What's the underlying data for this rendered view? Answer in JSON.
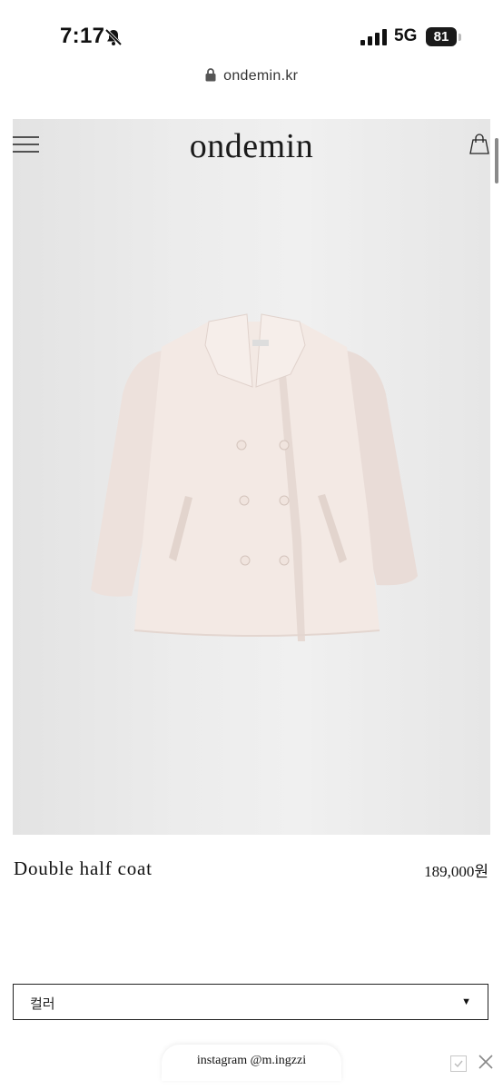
{
  "status_bar": {
    "time": "7:17",
    "network": "5G",
    "battery": "81"
  },
  "browser": {
    "url": "ondemin.kr"
  },
  "header": {
    "logo": "ondemin"
  },
  "product": {
    "name": "Double half coat",
    "price": "189,000원"
  },
  "options": {
    "color_label": "컬러"
  },
  "footer": {
    "instagram": "instagram @m.ingzzi"
  },
  "icons": [
    "bell-slash-icon",
    "signal-icon",
    "lock-icon",
    "menu-icon",
    "shopping-bag-icon",
    "caret-down-icon",
    "checkbox-icon",
    "close-icon"
  ],
  "colors": {
    "coat": "#f3e9e4",
    "background": "#ececec"
  }
}
